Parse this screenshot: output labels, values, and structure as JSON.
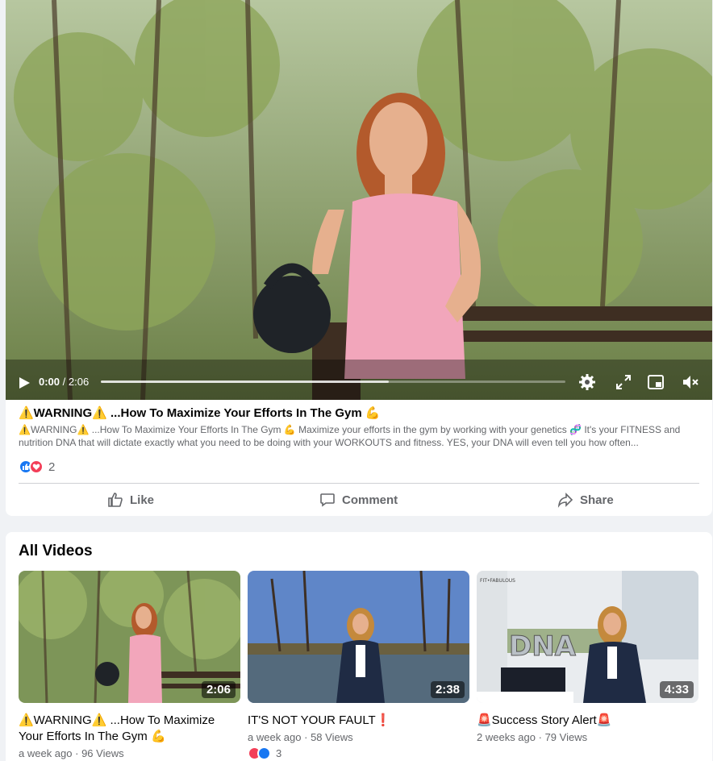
{
  "player": {
    "current_time": "0:00",
    "duration": "2:06",
    "buffered_fraction": 0.62
  },
  "post": {
    "title": "⚠️WARNING⚠️ ...How To Maximize Your Efforts In The Gym 💪",
    "description": "⚠️WARNING⚠️ ...How To Maximize Your Efforts In The Gym 💪 Maximize your efforts in the gym by working with your genetics 🧬 It's your FITNESS and nutrition DNA that will dictate exactly what you need to be doing with your WORKOUTS and fitness. YES, your DNA will even tell you how often...",
    "reaction_count": "2",
    "actions": {
      "like": "Like",
      "comment": "Comment",
      "share": "Share"
    }
  },
  "all_videos": {
    "heading": "All Videos",
    "items": [
      {
        "title": "⚠️WARNING⚠️ ...How To Maximize Your Efforts In The Gym 💪",
        "duration": "2:06",
        "age": "a week ago",
        "views": "96 Views"
      },
      {
        "title": "IT'S NOT YOUR FAULT❗",
        "duration": "2:38",
        "age": "a week ago",
        "views": "58 Views",
        "reactions": "3"
      },
      {
        "title": "🚨Success Story Alert🚨",
        "duration": "4:33",
        "age": "2 weeks ago",
        "views": "79 Views",
        "thumb_text": "DNA",
        "thumb_brand": "FIT•FABULOUS"
      }
    ]
  },
  "colors": {
    "like_blue": "#1877f2",
    "love_red": "#f33e58",
    "secondary_text": "#65676b"
  }
}
